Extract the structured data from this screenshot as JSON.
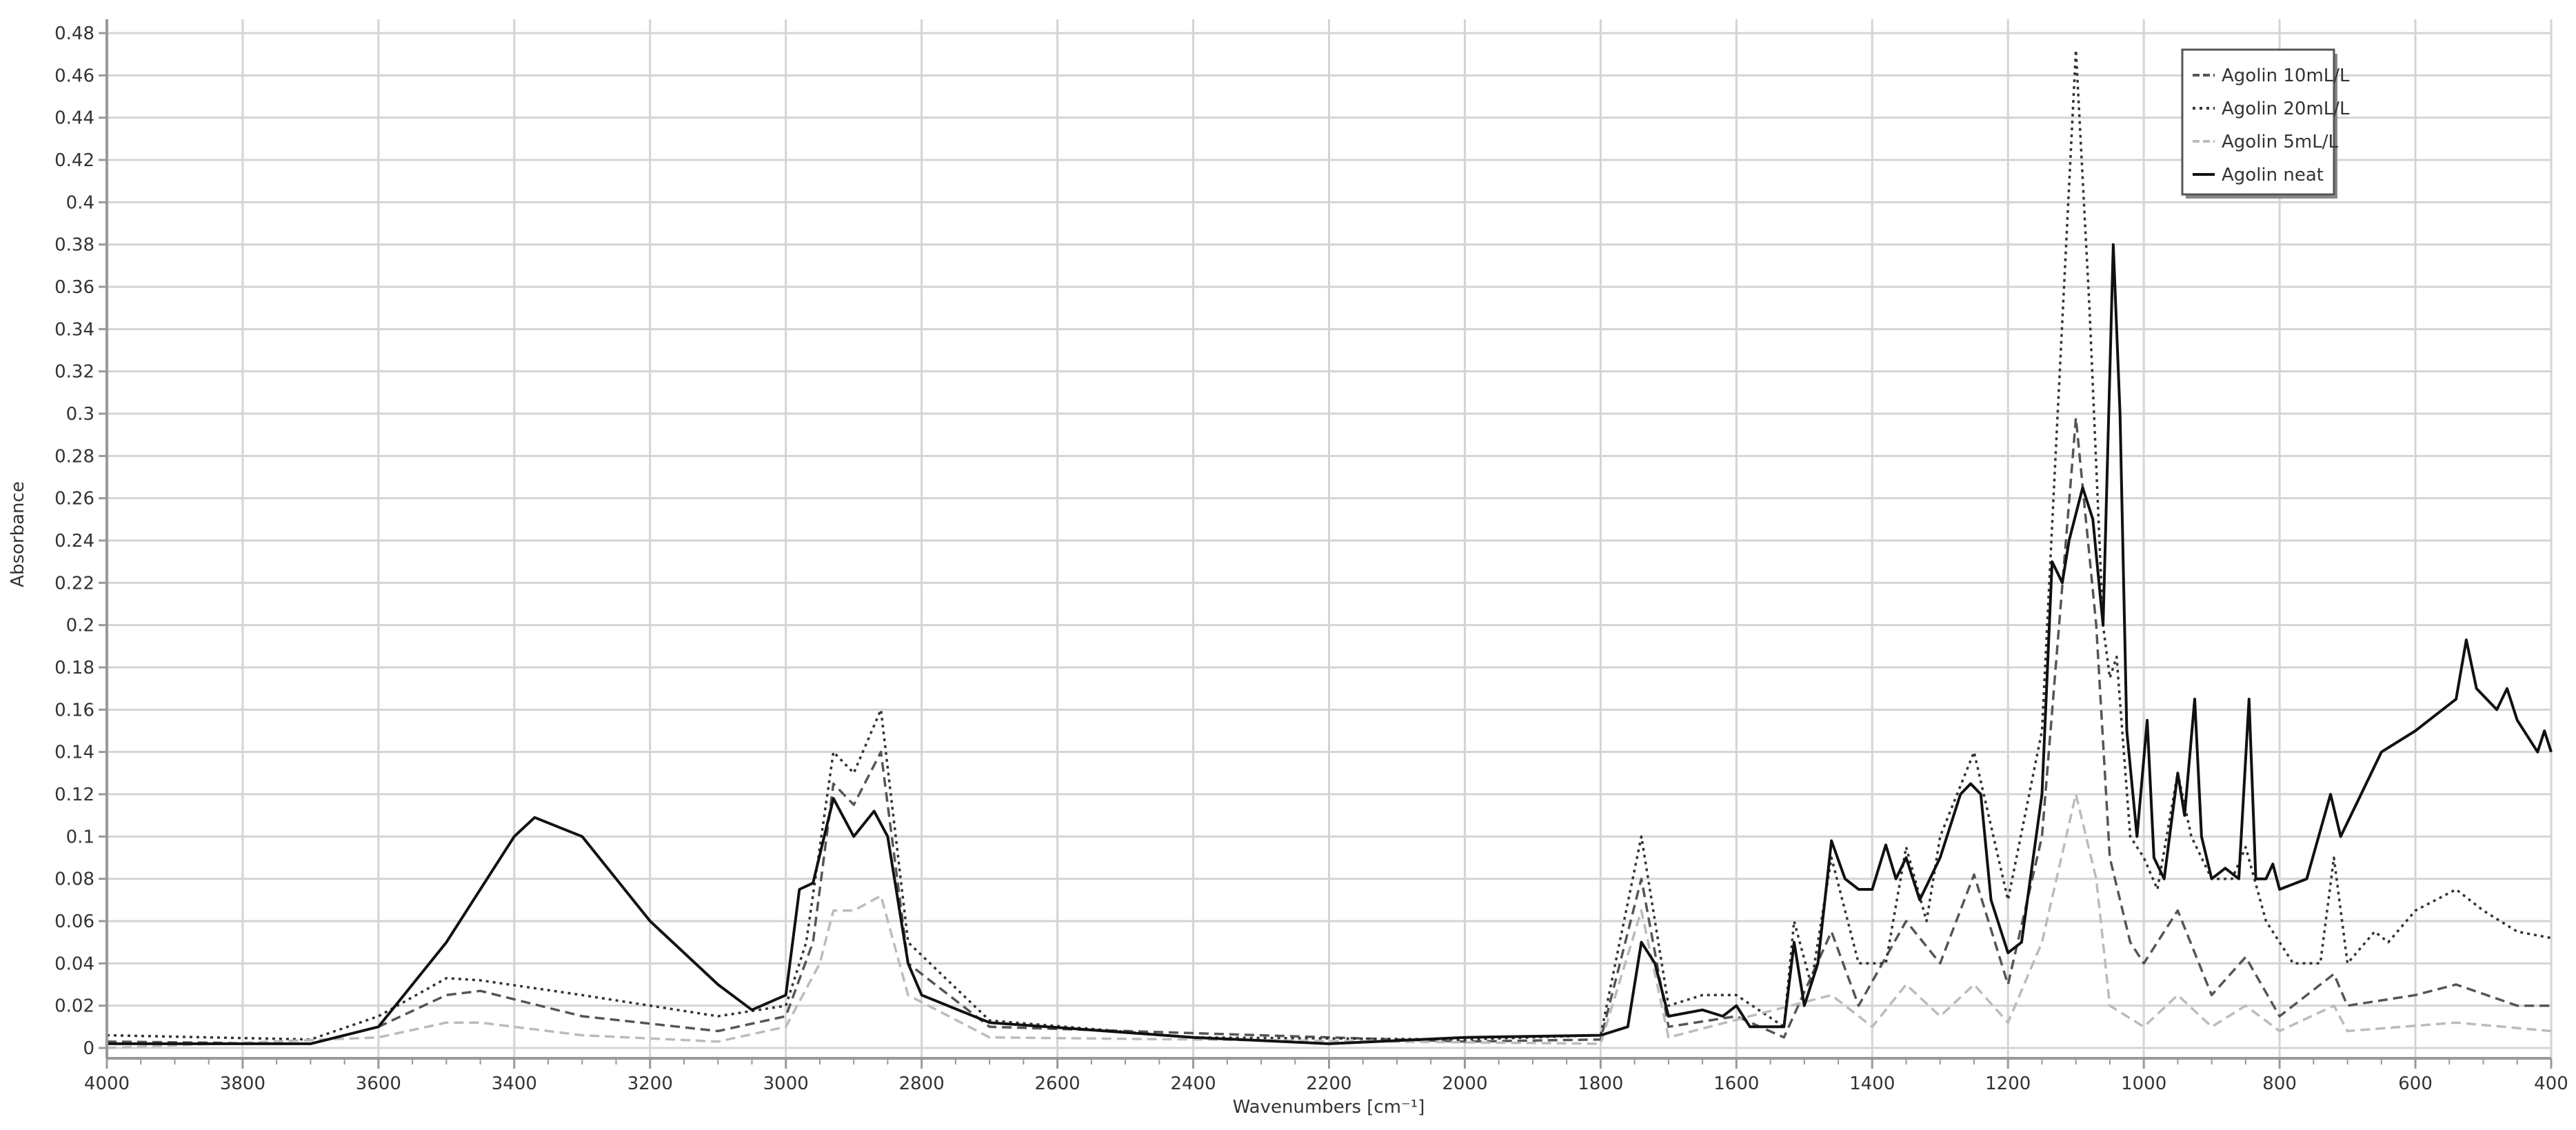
{
  "chart_data": {
    "type": "line",
    "title": "",
    "xlabel": "Wavenumbers [cm⁻¹]",
    "ylabel": "Absorbance",
    "xlim": [
      4000,
      400
    ],
    "ylim": [
      0,
      0.48
    ],
    "grid": true,
    "legend_position": "top-right",
    "xticks": [
      4000,
      3800,
      3600,
      3400,
      3200,
      3000,
      2800,
      2600,
      2400,
      2200,
      2000,
      1800,
      1600,
      1400,
      1200,
      1000,
      800,
      600,
      400
    ],
    "yticks": [
      "0",
      "0.02",
      "0.04",
      "0.06",
      "0.08",
      "0.1",
      "0.12",
      "0.14",
      "0.16",
      "0.18",
      "0.2",
      "0.22",
      "0.24",
      "0.26",
      "0.28",
      "0.3",
      "0.32",
      "0.34",
      "0.36",
      "0.38",
      "0.4",
      "0.42",
      "0.44",
      "0.46",
      "0.48"
    ],
    "series": [
      {
        "name": "Agolin 10mL/L",
        "style": "dashed",
        "color": "#555555",
        "points": [
          [
            4000,
            0.003
          ],
          [
            3700,
            0.002
          ],
          [
            3600,
            0.01
          ],
          [
            3500,
            0.025
          ],
          [
            3450,
            0.027
          ],
          [
            3300,
            0.015
          ],
          [
            3100,
            0.008
          ],
          [
            3000,
            0.015
          ],
          [
            2960,
            0.05
          ],
          [
            2930,
            0.125
          ],
          [
            2900,
            0.115
          ],
          [
            2860,
            0.14
          ],
          [
            2820,
            0.04
          ],
          [
            2700,
            0.01
          ],
          [
            2000,
            0.003
          ],
          [
            1800,
            0.004
          ],
          [
            1740,
            0.08
          ],
          [
            1700,
            0.01
          ],
          [
            1600,
            0.015
          ],
          [
            1530,
            0.005
          ],
          [
            1460,
            0.055
          ],
          [
            1420,
            0.02
          ],
          [
            1350,
            0.06
          ],
          [
            1300,
            0.04
          ],
          [
            1250,
            0.082
          ],
          [
            1200,
            0.03
          ],
          [
            1150,
            0.1
          ],
          [
            1100,
            0.298
          ],
          [
            1070,
            0.2
          ],
          [
            1050,
            0.09
          ],
          [
            1020,
            0.05
          ],
          [
            1000,
            0.04
          ],
          [
            950,
            0.065
          ],
          [
            900,
            0.025
          ],
          [
            850,
            0.043
          ],
          [
            800,
            0.015
          ],
          [
            720,
            0.035
          ],
          [
            700,
            0.02
          ],
          [
            600,
            0.025
          ],
          [
            540,
            0.03
          ],
          [
            450,
            0.02
          ],
          [
            400,
            0.02
          ]
        ]
      },
      {
        "name": "Agolin 20mL/L",
        "style": "dotted",
        "color": "#333333",
        "points": [
          [
            4000,
            0.006
          ],
          [
            3700,
            0.004
          ],
          [
            3600,
            0.015
          ],
          [
            3500,
            0.033
          ],
          [
            3450,
            0.032
          ],
          [
            3300,
            0.025
          ],
          [
            3100,
            0.015
          ],
          [
            3000,
            0.02
          ],
          [
            2970,
            0.05
          ],
          [
            2930,
            0.14
          ],
          [
            2900,
            0.13
          ],
          [
            2860,
            0.16
          ],
          [
            2820,
            0.05
          ],
          [
            2700,
            0.013
          ],
          [
            2400,
            0.005
          ],
          [
            2000,
            0.004
          ],
          [
            1800,
            0.006
          ],
          [
            1740,
            0.1
          ],
          [
            1700,
            0.02
          ],
          [
            1650,
            0.025
          ],
          [
            1600,
            0.025
          ],
          [
            1530,
            0.01
          ],
          [
            1515,
            0.06
          ],
          [
            1490,
            0.03
          ],
          [
            1460,
            0.09
          ],
          [
            1420,
            0.04
          ],
          [
            1380,
            0.04
          ],
          [
            1350,
            0.095
          ],
          [
            1320,
            0.06
          ],
          [
            1300,
            0.1
          ],
          [
            1250,
            0.14
          ],
          [
            1200,
            0.07
          ],
          [
            1150,
            0.15
          ],
          [
            1130,
            0.28
          ],
          [
            1100,
            0.472
          ],
          [
            1080,
            0.35
          ],
          [
            1060,
            0.2
          ],
          [
            1050,
            0.175
          ],
          [
            1040,
            0.185
          ],
          [
            1020,
            0.1
          ],
          [
            1000,
            0.09
          ],
          [
            980,
            0.075
          ],
          [
            950,
            0.13
          ],
          [
            930,
            0.1
          ],
          [
            900,
            0.08
          ],
          [
            870,
            0.08
          ],
          [
            850,
            0.095
          ],
          [
            820,
            0.06
          ],
          [
            780,
            0.04
          ],
          [
            740,
            0.04
          ],
          [
            720,
            0.09
          ],
          [
            700,
            0.04
          ],
          [
            660,
            0.055
          ],
          [
            640,
            0.05
          ],
          [
            600,
            0.065
          ],
          [
            540,
            0.075
          ],
          [
            500,
            0.065
          ],
          [
            450,
            0.055
          ],
          [
            400,
            0.052
          ]
        ]
      },
      {
        "name": "Agolin 5mL/L",
        "style": "dashed",
        "color": "#bbbbbb",
        "points": [
          [
            4000,
            0.0
          ],
          [
            3600,
            0.005
          ],
          [
            3500,
            0.012
          ],
          [
            3450,
            0.012
          ],
          [
            3300,
            0.006
          ],
          [
            3100,
            0.003
          ],
          [
            3000,
            0.01
          ],
          [
            2950,
            0.04
          ],
          [
            2930,
            0.065
          ],
          [
            2900,
            0.065
          ],
          [
            2860,
            0.072
          ],
          [
            2820,
            0.025
          ],
          [
            2700,
            0.005
          ],
          [
            1800,
            0.002
          ],
          [
            1740,
            0.065
          ],
          [
            1700,
            0.005
          ],
          [
            1460,
            0.025
          ],
          [
            1400,
            0.01
          ],
          [
            1350,
            0.03
          ],
          [
            1300,
            0.015
          ],
          [
            1250,
            0.03
          ],
          [
            1200,
            0.012
          ],
          [
            1150,
            0.05
          ],
          [
            1100,
            0.12
          ],
          [
            1070,
            0.08
          ],
          [
            1050,
            0.02
          ],
          [
            1000,
            0.01
          ],
          [
            950,
            0.025
          ],
          [
            900,
            0.01
          ],
          [
            850,
            0.02
          ],
          [
            800,
            0.008
          ],
          [
            720,
            0.02
          ],
          [
            700,
            0.008
          ],
          [
            540,
            0.012
          ],
          [
            400,
            0.008
          ]
        ]
      },
      {
        "name": "Agolin neat",
        "style": "solid",
        "color": "#111111",
        "points": [
          [
            4000,
            0.002
          ],
          [
            3700,
            0.002
          ],
          [
            3600,
            0.01
          ],
          [
            3500,
            0.05
          ],
          [
            3400,
            0.1
          ],
          [
            3370,
            0.109
          ],
          [
            3300,
            0.1
          ],
          [
            3200,
            0.06
          ],
          [
            3100,
            0.03
          ],
          [
            3050,
            0.018
          ],
          [
            3000,
            0.025
          ],
          [
            2980,
            0.075
          ],
          [
            2960,
            0.078
          ],
          [
            2930,
            0.118
          ],
          [
            2900,
            0.1
          ],
          [
            2870,
            0.112
          ],
          [
            2850,
            0.1
          ],
          [
            2820,
            0.04
          ],
          [
            2800,
            0.025
          ],
          [
            2700,
            0.012
          ],
          [
            2400,
            0.005
          ],
          [
            2200,
            0.002
          ],
          [
            2000,
            0.005
          ],
          [
            1800,
            0.006
          ],
          [
            1760,
            0.01
          ],
          [
            1740,
            0.05
          ],
          [
            1720,
            0.04
          ],
          [
            1700,
            0.015
          ],
          [
            1650,
            0.018
          ],
          [
            1620,
            0.015
          ],
          [
            1600,
            0.02
          ],
          [
            1580,
            0.01
          ],
          [
            1530,
            0.01
          ],
          [
            1515,
            0.05
          ],
          [
            1500,
            0.02
          ],
          [
            1480,
            0.04
          ],
          [
            1460,
            0.098
          ],
          [
            1440,
            0.08
          ],
          [
            1420,
            0.075
          ],
          [
            1400,
            0.075
          ],
          [
            1380,
            0.096
          ],
          [
            1365,
            0.08
          ],
          [
            1350,
            0.09
          ],
          [
            1330,
            0.07
          ],
          [
            1300,
            0.09
          ],
          [
            1270,
            0.12
          ],
          [
            1255,
            0.125
          ],
          [
            1240,
            0.12
          ],
          [
            1225,
            0.07
          ],
          [
            1200,
            0.045
          ],
          [
            1180,
            0.05
          ],
          [
            1150,
            0.12
          ],
          [
            1135,
            0.23
          ],
          [
            1120,
            0.22
          ],
          [
            1110,
            0.24
          ],
          [
            1090,
            0.265
          ],
          [
            1075,
            0.25
          ],
          [
            1060,
            0.2
          ],
          [
            1045,
            0.38
          ],
          [
            1035,
            0.3
          ],
          [
            1025,
            0.15
          ],
          [
            1010,
            0.1
          ],
          [
            995,
            0.155
          ],
          [
            985,
            0.09
          ],
          [
            970,
            0.08
          ],
          [
            950,
            0.13
          ],
          [
            940,
            0.11
          ],
          [
            925,
            0.165
          ],
          [
            915,
            0.1
          ],
          [
            900,
            0.08
          ],
          [
            880,
            0.085
          ],
          [
            860,
            0.08
          ],
          [
            845,
            0.165
          ],
          [
            835,
            0.08
          ],
          [
            820,
            0.08
          ],
          [
            810,
            0.087
          ],
          [
            800,
            0.075
          ],
          [
            760,
            0.08
          ],
          [
            725,
            0.12
          ],
          [
            710,
            0.1
          ],
          [
            680,
            0.12
          ],
          [
            650,
            0.14
          ],
          [
            600,
            0.15
          ],
          [
            560,
            0.16
          ],
          [
            540,
            0.165
          ],
          [
            525,
            0.193
          ],
          [
            510,
            0.17
          ],
          [
            480,
            0.16
          ],
          [
            465,
            0.17
          ],
          [
            450,
            0.155
          ],
          [
            420,
            0.14
          ],
          [
            410,
            0.15
          ],
          [
            400,
            0.14
          ]
        ]
      }
    ]
  }
}
